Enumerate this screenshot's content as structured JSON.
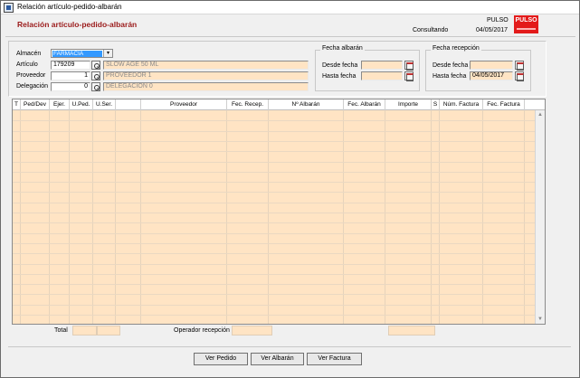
{
  "window": {
    "title": "Relación artículo-pedido-albarán"
  },
  "header": {
    "heading": "Relación artículo-pedido-albarán",
    "status": "Consultando",
    "company": "PULSO",
    "date": "04/05/2017",
    "logo_text": "PULSO"
  },
  "filters": {
    "almacen": {
      "label": "Almacén",
      "value": "FARMACIA",
      "arrow": "▾"
    },
    "articulo": {
      "label": "Artículo",
      "code": "179209",
      "desc": "SLOW AGE  50 ML"
    },
    "proveedor": {
      "label": "Proveedor",
      "code": "1",
      "desc": "PROVEEDOR 1"
    },
    "delegacion": {
      "label": "Delegación",
      "code": "0",
      "desc": "DELEGACION 0"
    }
  },
  "fecha_albaran": {
    "title": "Fecha albarán",
    "desde_label": "Desde fecha",
    "desde_value": "",
    "hasta_label": "Hasta  fecha",
    "hasta_value": ""
  },
  "fecha_recepcion": {
    "title": "Fecha recepción",
    "desde_label": "Desde fecha",
    "desde_value": "",
    "hasta_label": "Hasta  fecha",
    "hasta_value": "04/05/2017"
  },
  "grid": {
    "columns": [
      "T",
      "Ped/Dev",
      "Ejer.",
      "U.Ped.",
      "U.Ser.",
      "",
      "Proveedor",
      "Fec. Recep.",
      "Nº Albarán",
      "Fec. Albarán",
      "Importe",
      "S",
      "Núm. Factura",
      "Fec. Factura"
    ],
    "rows": [],
    "scroll_up": "▲",
    "scroll_down": "▼"
  },
  "totals": {
    "total_label": "Total",
    "operador_label": "Operador recepción"
  },
  "buttons": {
    "ver_pedido": "Ver Pedido",
    "ver_albaran": "Ver Albarán",
    "ver_factura": "Ver Factura"
  }
}
